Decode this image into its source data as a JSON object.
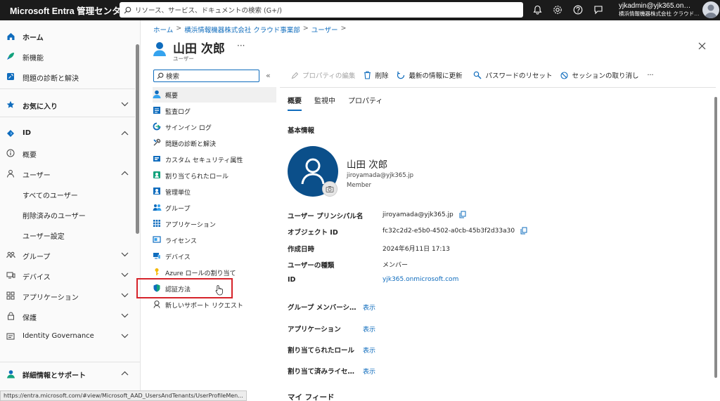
{
  "topbar": {
    "brand": "Microsoft Entra 管理センター",
    "search_placeholder": "リソース、サービス、ドキュメントの検索 (G+/)",
    "account_name": "yjkadmin@yjk365.on…",
    "account_org": "横浜情報機器株式会社 クラウド…",
    "icons": [
      "bell-icon",
      "gear-icon",
      "help-icon",
      "feedback-icon"
    ]
  },
  "leftnav": {
    "home": "ホーム",
    "whats_new": "新機能",
    "diagnose": "問題の診断と解決",
    "favorites": "お気に入り",
    "id": "ID",
    "overview": "概要",
    "users": "ユーザー",
    "all_users": "すべてのユーザー",
    "deleted_users": "削除済みのユーザー",
    "user_settings": "ユーザー設定",
    "groups": "グループ",
    "devices": "デバイス",
    "applications": "アプリケーション",
    "protection": "保護",
    "identity_governance": "Identity Governance",
    "more_help": "詳細情報とサポート"
  },
  "status_url": "https://entra.microsoft.com/#view/Microsoft_AAD_UsersAndTenants/UserProfileMen...",
  "breadcrumb": [
    "ホーム",
    "横浜情報機器株式会社 クラウド事業部",
    "ユーザー"
  ],
  "page": {
    "title": "山田 次郎",
    "subtitle": "ユーザー",
    "more": "···"
  },
  "resource_menu": {
    "search_placeholder": "検索",
    "collapse": "«",
    "items": [
      {
        "label": "概要"
      },
      {
        "label": "監査ログ"
      },
      {
        "label": "サインイン ログ"
      },
      {
        "label": "問題の診断と解決"
      },
      {
        "label": "カスタム セキュリティ属性"
      },
      {
        "label": "割り当てられたロール"
      },
      {
        "label": "管理単位"
      },
      {
        "label": "グループ"
      },
      {
        "label": "アプリケーション"
      },
      {
        "label": "ライセンス"
      },
      {
        "label": "デバイス"
      },
      {
        "label": "Azure ロールの割り当て"
      },
      {
        "label": "認証方法"
      },
      {
        "label": "新しいサポート リクエスト"
      }
    ]
  },
  "toolbar": {
    "edit": "プロパティの編集",
    "delete": "削除",
    "refresh": "最新の情報に更新",
    "reset_password": "パスワードのリセット",
    "revoke_sessions": "セッションの取り消し",
    "more": "···"
  },
  "tabs": [
    "概要",
    "監視中",
    "プロパティ"
  ],
  "basic_info": {
    "heading": "基本情報",
    "name": "山田 次郎",
    "email": "jiroyamada@yjk365.jp",
    "type": "Member"
  },
  "properties": [
    {
      "label": "ユーザー プリンシパル名",
      "value": "jiroyamada@yjk365.jp",
      "copy": true
    },
    {
      "label": "オブジェクト ID",
      "value": "fc32c2d2-e5b0-4502-a0cb-45b3f2d33a30",
      "copy": true
    },
    {
      "label": "作成日時",
      "value": "2024年6月11日 17:13",
      "copy": false
    },
    {
      "label": "ユーザーの種類",
      "value": "メンバー",
      "copy": false
    },
    {
      "label": "ID",
      "value": "yjk365.onmicrosoft.com",
      "copy": false,
      "link": true
    }
  ],
  "summary": [
    {
      "label": "グループ メンバーシ…",
      "action": "表示"
    },
    {
      "label": "アプリケーション",
      "action": "表示"
    },
    {
      "label": "割り当てられたロール",
      "action": "表示"
    },
    {
      "label": "割り当て済みライセ…",
      "action": "表示"
    }
  ],
  "my_feed": "マイ フィード",
  "colors": {
    "accent": "#0f6cbd",
    "topbar": "#1b1b1b",
    "highlight": "#d6232a"
  }
}
